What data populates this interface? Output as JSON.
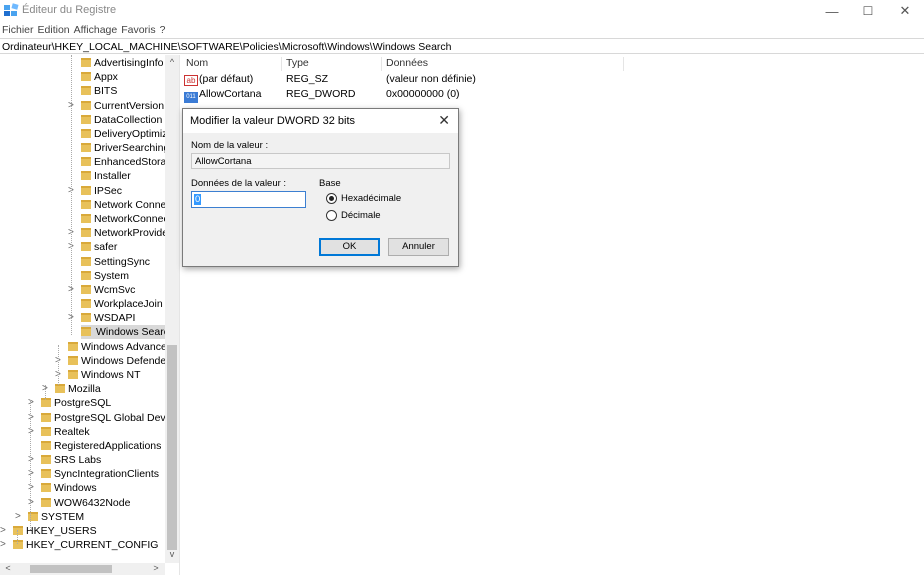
{
  "window": {
    "title": "Éditeur du Registre",
    "minimize_glyph": "—",
    "maximize_glyph": "☐",
    "close_glyph": "✕"
  },
  "menu": [
    "Fichier",
    "Edition",
    "Affichage",
    "Favoris",
    "?"
  ],
  "address": "Ordinateur\\HKEY_LOCAL_MACHINE\\SOFTWARE\\Policies\\Microsoft\\Windows\\Windows Search",
  "tree": [
    {
      "label": "AdvertisingInfo",
      "expandable": false
    },
    {
      "label": "Appx",
      "expandable": false
    },
    {
      "label": "BITS",
      "expandable": false
    },
    {
      "label": "CurrentVersion",
      "expandable": true
    },
    {
      "label": "DataCollection",
      "expandable": false
    },
    {
      "label": "DeliveryOptimizatic",
      "expandable": false
    },
    {
      "label": "DriverSearching",
      "expandable": false
    },
    {
      "label": "EnhancedStorageD",
      "expandable": false
    },
    {
      "label": "Installer",
      "expandable": false
    },
    {
      "label": "IPSec",
      "expandable": true
    },
    {
      "label": "Network Connectio",
      "expandable": false
    },
    {
      "label": "NetworkConnectivi",
      "expandable": false
    },
    {
      "label": "NetworkProvider",
      "expandable": true
    },
    {
      "label": "safer",
      "expandable": true
    },
    {
      "label": "SettingSync",
      "expandable": false
    },
    {
      "label": "System",
      "expandable": false
    },
    {
      "label": "WcmSvc",
      "expandable": true
    },
    {
      "label": "WorkplaceJoin",
      "expandable": false
    },
    {
      "label": "WSDAPI",
      "expandable": true
    },
    {
      "label": "Windows Search",
      "expandable": false,
      "selected": true
    },
    {
      "label": "Windows Advanced Th",
      "expandable": false
    },
    {
      "label": "Windows Defender",
      "expandable": true
    },
    {
      "label": "Windows NT",
      "expandable": true
    },
    {
      "label": "Mozilla",
      "expandable": true
    },
    {
      "label": "PostgreSQL",
      "expandable": true
    },
    {
      "label": "PostgreSQL Global Developr",
      "expandable": true
    },
    {
      "label": "Realtek",
      "expandable": true
    },
    {
      "label": "RegisteredApplications",
      "expandable": false
    },
    {
      "label": "SRS Labs",
      "expandable": true
    },
    {
      "label": "SyncIntegrationClients",
      "expandable": true
    },
    {
      "label": "Windows",
      "expandable": true
    },
    {
      "label": "WOW6432Node",
      "expandable": true
    },
    {
      "label": "SYSTEM",
      "expandable": true
    },
    {
      "label": "HKEY_USERS",
      "expandable": true
    },
    {
      "label": "HKEY_CURRENT_CONFIG",
      "expandable": true
    }
  ],
  "list": {
    "headers": {
      "name": "Nom",
      "type": "Type",
      "data": "Données"
    },
    "rows": [
      {
        "icon": "string-value-icon",
        "icon_text": "ab",
        "name": "(par défaut)",
        "type": "REG_SZ",
        "data": "(valeur non définie)"
      },
      {
        "icon": "binary-value-icon",
        "icon_text": "011",
        "name": "AllowCortana",
        "type": "REG_DWORD",
        "data": "0x00000000 (0)"
      }
    ]
  },
  "dialog": {
    "title": "Modifier la valeur DWORD 32 bits",
    "name_label": "Nom de la valeur :",
    "name_value": "AllowCortana",
    "data_label": "Données de la valeur :",
    "data_value": "0",
    "base_label": "Base",
    "radio_hex": "Hexadécimale",
    "radio_dec": "Décimale",
    "selected_base": "hex",
    "ok": "OK",
    "cancel": "Annuler"
  },
  "colors": {
    "selection": "#d9d9d9",
    "folder": "#e8c15a",
    "accent": "#0078d7"
  }
}
